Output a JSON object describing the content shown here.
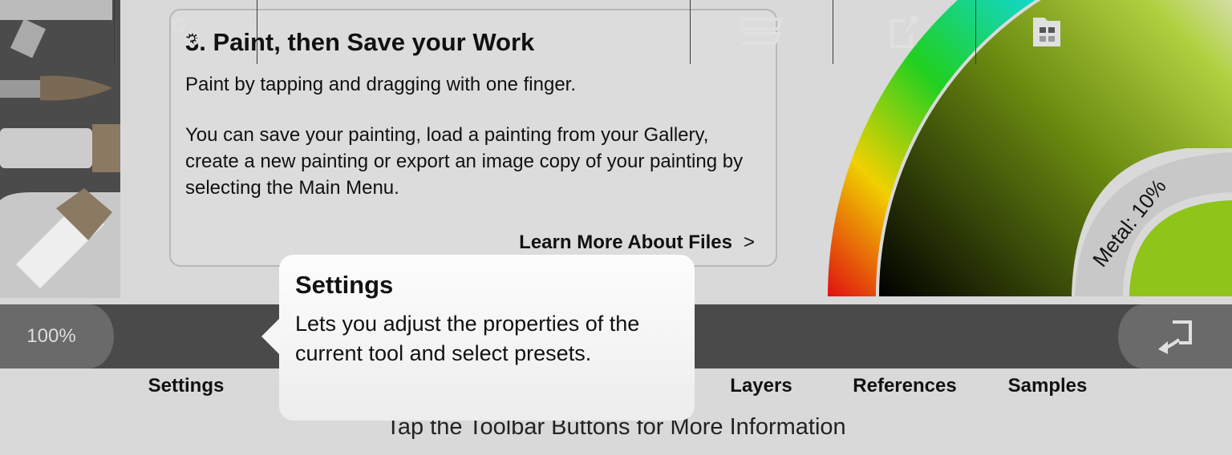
{
  "card": {
    "title": "3. Paint, then Save your Work",
    "p1": "Paint by tapping and dragging with one finger.",
    "p2": "You can save your painting, load a painting from your Gallery, create a new painting or export an image copy of your painting by selecting the Main Menu.",
    "link": "Learn More About Files",
    "link_icon": ">"
  },
  "color_picker": {
    "metal_label": "Metal: 10%",
    "swatch_color": "#8fc41a"
  },
  "toolbar": {
    "zoom": "100%",
    "buttons": [
      {
        "label": "Settings",
        "icon": "gears-icon"
      },
      {
        "label": "Layers",
        "icon": "layers-icon"
      },
      {
        "label": "References",
        "icon": "reference-icon"
      },
      {
        "label": "Samples",
        "icon": "samples-icon"
      }
    ],
    "back_icon": "return-icon"
  },
  "tooltip": {
    "title": "Settings",
    "body": "Lets you adjust the properties of the current tool and select presets."
  },
  "hint": "Tap the Toolbar Buttons for More Information"
}
